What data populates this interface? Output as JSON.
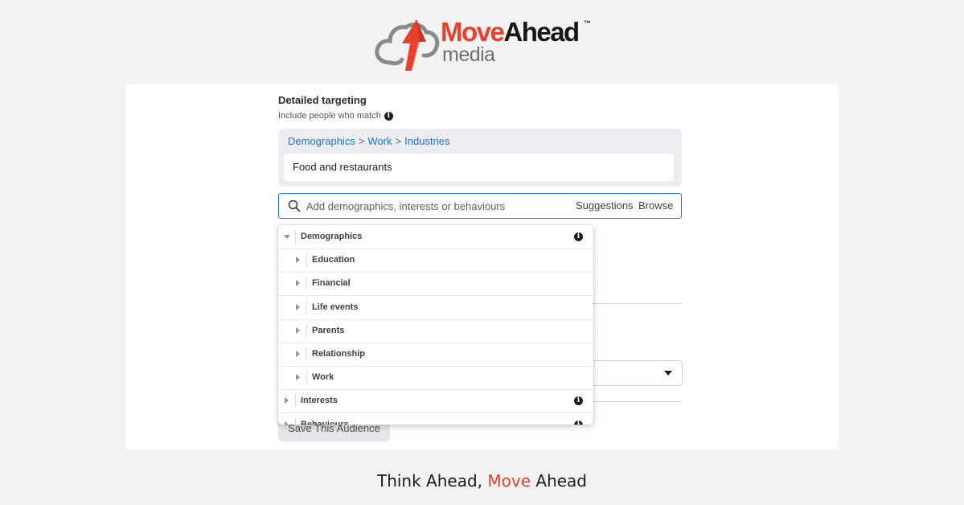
{
  "logo": {
    "brand_move": "Move",
    "brand_ahead": "Ahead",
    "trademark": "™",
    "sub": "media",
    "accent_color": "#e8402c"
  },
  "targeting": {
    "title": "Detailed targeting",
    "subtitle": "Include people who match",
    "info_icon": "info-circle-icon",
    "breadcrumb": [
      "Demographics",
      "Work",
      "Industries"
    ],
    "breadcrumb_separator": ">",
    "selected_item": "Food and restaurants",
    "search": {
      "icon": "search-icon",
      "placeholder": "Add demographics, interests or behaviours",
      "value": "",
      "suggestions_label": "Suggestions",
      "browse_label": "Browse"
    }
  },
  "dropdown": {
    "items": [
      {
        "label": "Demographics",
        "expanded": true,
        "level": 0,
        "info": true
      },
      {
        "label": "Education",
        "expanded": false,
        "level": 1,
        "info": false
      },
      {
        "label": "Financial",
        "expanded": false,
        "level": 1,
        "info": false
      },
      {
        "label": "Life events",
        "expanded": false,
        "level": 1,
        "info": false
      },
      {
        "label": "Parents",
        "expanded": false,
        "level": 1,
        "info": false
      },
      {
        "label": "Relationship",
        "expanded": false,
        "level": 1,
        "info": false
      },
      {
        "label": "Work",
        "expanded": false,
        "level": 1,
        "info": false
      },
      {
        "label": "Interests",
        "expanded": false,
        "level": 0,
        "info": true
      },
      {
        "label": "Behaviours",
        "expanded": false,
        "level": 0,
        "info": true
      }
    ]
  },
  "save_button_label": "Save This Audience",
  "tagline": {
    "part1": "Think Ahead, ",
    "accent": "Move",
    "part2": " Ahead"
  },
  "colors": {
    "link": "#1b74e4",
    "focus_border": "#1b74e4",
    "page_background": "#f2f2f2"
  }
}
